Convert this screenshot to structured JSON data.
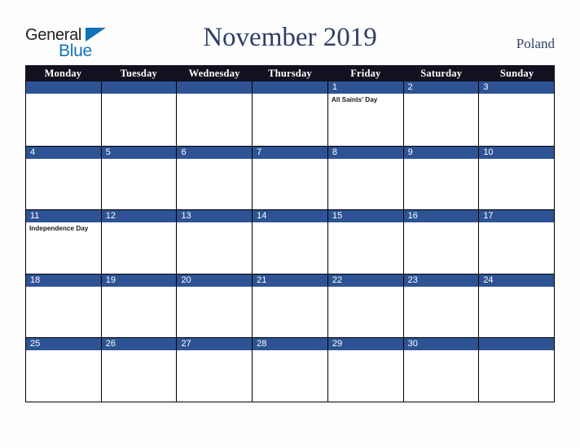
{
  "brand": {
    "name_part1": "General",
    "name_part2": "Blue",
    "triangle_icon": "triangle-icon",
    "color_dark": "#231f20",
    "color_blue": "#1272b8"
  },
  "header": {
    "title": "November 2019",
    "country": "Poland",
    "title_color": "#2e3f66"
  },
  "calendar": {
    "weekday_headers": [
      "Monday",
      "Tuesday",
      "Wednesday",
      "Thursday",
      "Friday",
      "Saturday",
      "Sunday"
    ],
    "header_bg": "#11111f",
    "band_color": "#2e5395",
    "weeks": [
      [
        {
          "day": "",
          "events": []
        },
        {
          "day": "",
          "events": []
        },
        {
          "day": "",
          "events": []
        },
        {
          "day": "",
          "events": []
        },
        {
          "day": "1",
          "events": [
            "All Saints’ Day"
          ]
        },
        {
          "day": "2",
          "events": []
        },
        {
          "day": "3",
          "events": []
        }
      ],
      [
        {
          "day": "4",
          "events": []
        },
        {
          "day": "5",
          "events": []
        },
        {
          "day": "6",
          "events": []
        },
        {
          "day": "7",
          "events": []
        },
        {
          "day": "8",
          "events": []
        },
        {
          "day": "9",
          "events": []
        },
        {
          "day": "10",
          "events": []
        }
      ],
      [
        {
          "day": "11",
          "events": [
            "Independence Day"
          ]
        },
        {
          "day": "12",
          "events": []
        },
        {
          "day": "13",
          "events": []
        },
        {
          "day": "14",
          "events": []
        },
        {
          "day": "15",
          "events": []
        },
        {
          "day": "16",
          "events": []
        },
        {
          "day": "17",
          "events": []
        }
      ],
      [
        {
          "day": "18",
          "events": []
        },
        {
          "day": "19",
          "events": []
        },
        {
          "day": "20",
          "events": []
        },
        {
          "day": "21",
          "events": []
        },
        {
          "day": "22",
          "events": []
        },
        {
          "day": "23",
          "events": []
        },
        {
          "day": "24",
          "events": []
        }
      ],
      [
        {
          "day": "25",
          "events": []
        },
        {
          "day": "26",
          "events": []
        },
        {
          "day": "27",
          "events": []
        },
        {
          "day": "28",
          "events": []
        },
        {
          "day": "29",
          "events": []
        },
        {
          "day": "30",
          "events": []
        },
        {
          "day": "",
          "events": []
        }
      ]
    ]
  }
}
